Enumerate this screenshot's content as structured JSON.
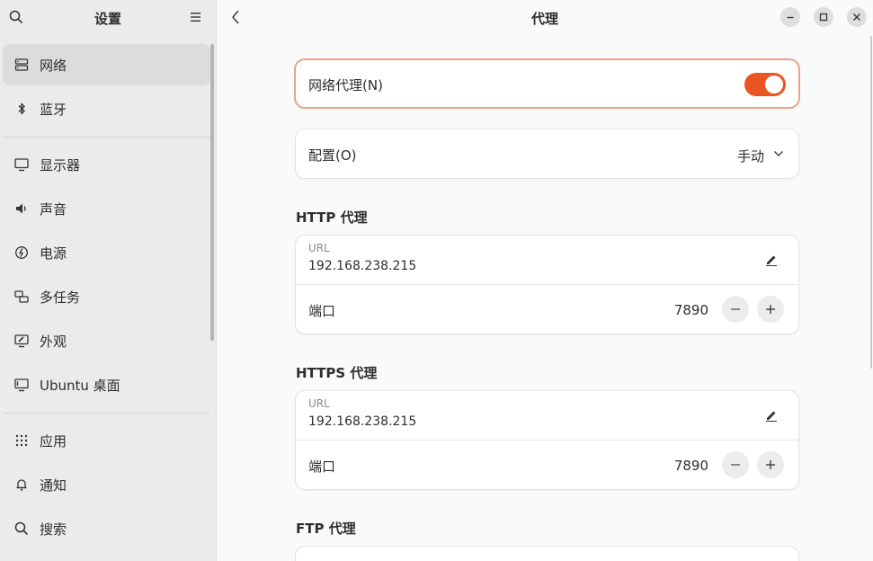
{
  "sidebar": {
    "title": "设置",
    "items": [
      {
        "label": "网络",
        "icon": "network-icon"
      },
      {
        "label": "蓝牙",
        "icon": "bluetooth-icon"
      },
      {
        "label": "显示器",
        "icon": "display-icon"
      },
      {
        "label": "声音",
        "icon": "sound-icon"
      },
      {
        "label": "电源",
        "icon": "power-icon"
      },
      {
        "label": "多任务",
        "icon": "multitasking-icon"
      },
      {
        "label": "外观",
        "icon": "appearance-icon"
      },
      {
        "label": "Ubuntu 桌面",
        "icon": "ubuntu-desktop-icon"
      },
      {
        "label": "应用",
        "icon": "apps-icon"
      },
      {
        "label": "通知",
        "icon": "bell-icon"
      },
      {
        "label": "搜索",
        "icon": "search-icon"
      }
    ],
    "active_index": 0
  },
  "header": {
    "title": "代理"
  },
  "proxy": {
    "network_proxy_label": "网络代理(N)",
    "network_proxy_enabled": true,
    "config_label": "配置(O)",
    "config_value": "手动",
    "http": {
      "title": "HTTP 代理",
      "url_caption": "URL",
      "url": "192.168.238.215",
      "port_label": "端口",
      "port": "7890"
    },
    "https": {
      "title": "HTTPS 代理",
      "url_caption": "URL",
      "url": "192.168.238.215",
      "port_label": "端口",
      "port": "7890"
    },
    "ftp": {
      "title": "FTP 代理"
    }
  },
  "colors": {
    "accent": "#e95420",
    "focus_border": "#e9a38a"
  }
}
